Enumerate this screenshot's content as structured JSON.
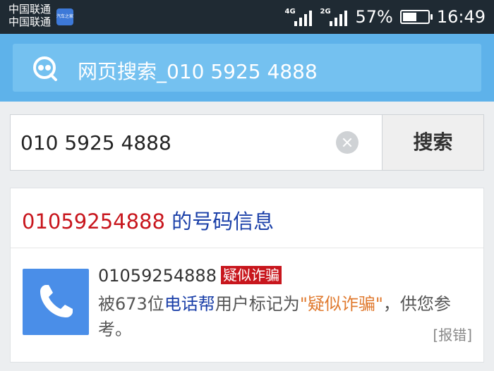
{
  "status_bar": {
    "carrier_1": "中国联通",
    "carrier_2": "中国联通",
    "app_badge": "汽车之家",
    "network_1": "4G",
    "network_2": "2G",
    "battery_percent": "57%",
    "battery_level": 0.57,
    "time": "16:49"
  },
  "header": {
    "logo_icon": "search-mask-icon",
    "title": "网页搜索_010 5925 4888"
  },
  "search": {
    "query": "010 5925 4888",
    "button_label": "搜索"
  },
  "result": {
    "number_heading": "01059254888",
    "heading_suffix": " 的号码信息",
    "phone_icon": "phone-icon",
    "number": "01059254888",
    "badge": "疑似诈骗",
    "desc_prefix": "被673位",
    "desc_source": "电话帮",
    "desc_mid": "用户标记为",
    "desc_tag": "\"疑似诈骗\"",
    "desc_suffix": "，供您参考。",
    "report_label": "[报错]"
  },
  "colors": {
    "statusbar_bg": "#1f2a33",
    "appbar_bg": "#5eb2ea",
    "accent_red": "#c8161d",
    "accent_blue": "#1a3fa8",
    "warn_orange": "#e07a2f",
    "phone_tile": "#4a8ee8"
  }
}
